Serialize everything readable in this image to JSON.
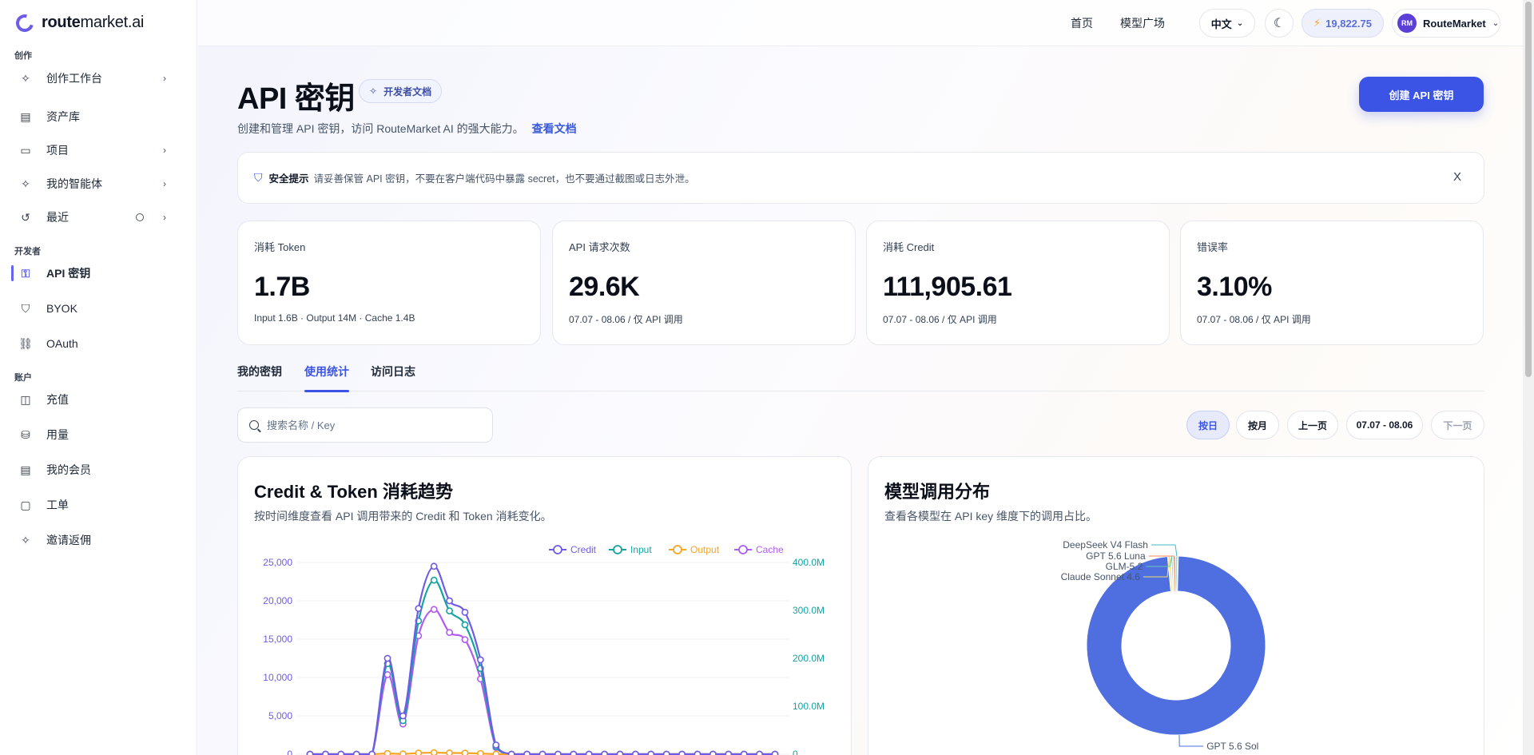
{
  "brand": {
    "name_bold": "route",
    "name_rest": "market.ai"
  },
  "sidebar": {
    "sections": {
      "create": "创作",
      "developer": "开发者",
      "account": "账户"
    },
    "items": [
      {
        "label": "创作工作台",
        "icon": "sparkle-icon"
      },
      {
        "label": "资产库",
        "icon": "library-icon"
      },
      {
        "label": "项目",
        "icon": "folder-icon"
      },
      {
        "label": "我的智能体",
        "icon": "agent-icon"
      },
      {
        "label": "最近",
        "icon": "history-icon"
      },
      {
        "label": "API 密钥",
        "icon": "key-icon"
      },
      {
        "label": "BYOK",
        "icon": "shield-icon"
      },
      {
        "label": "OAuth",
        "icon": "link-icon"
      },
      {
        "label": "充值",
        "icon": "wallet-icon"
      },
      {
        "label": "用量",
        "icon": "database-icon"
      },
      {
        "label": "我的会员",
        "icon": "receipt-icon"
      },
      {
        "label": "工单",
        "icon": "message-icon"
      },
      {
        "label": "邀请返佣",
        "icon": "sparkle-icon"
      }
    ]
  },
  "topbar": {
    "links": [
      "首页",
      "模型广场"
    ],
    "lang": "中文",
    "credits": "19,822.75",
    "user": {
      "initials": "RM",
      "name": "RouteMarket"
    }
  },
  "header": {
    "title": "API 密钥",
    "doc_chip": "开发者文档",
    "subtitle": "创建和管理 API 密钥，访问 RouteMarket AI 的强大能力。",
    "doc_link": "查看文档",
    "create_button": "创建 API 密钥"
  },
  "notice": {
    "title": "安全提示",
    "text": "请妥善保管 API 密钥，不要在客户端代码中暴露 secret，也不要通过截图或日志外泄。",
    "close": "X"
  },
  "stats": [
    {
      "label": "消耗 Token",
      "value": "1.7B",
      "sub": "Input 1.6B · Output 14M · Cache 1.4B"
    },
    {
      "label": "API 请求次数",
      "value": "29.6K",
      "sub": "07.07 - 08.06 / 仅 API 调用"
    },
    {
      "label": "消耗 Credit",
      "value": "111,905.61",
      "sub": "07.07 - 08.06 / 仅 API 调用"
    },
    {
      "label": "错误率",
      "value": "3.10%",
      "sub": "07.07 - 08.06 / 仅 API 调用"
    }
  ],
  "tabs": [
    "我的密钥",
    "使用统计",
    "访问日志"
  ],
  "search": {
    "placeholder": "搜索名称 / Key"
  },
  "filters": {
    "by_day": "按日",
    "by_month": "按月",
    "prev": "上一页",
    "range": "07.07 - 08.06",
    "next": "下一页"
  },
  "trend_card": {
    "title": "Credit & Token 消耗趋势",
    "desc": "按时间维度查看 API 调用带来的 Credit 和 Token 消耗变化。"
  },
  "dist_card": {
    "title": "模型调用分布",
    "desc": "查看各模型在 API key 维度下的调用占比。"
  },
  "chart_data": [
    {
      "type": "line",
      "legend": [
        "Credit",
        "Input",
        "Output",
        "Cache"
      ],
      "legend_position": "top-right",
      "y_left": {
        "ticks": [
          "0",
          "5,000",
          "10,000",
          "15,000",
          "20,000",
          "25,000"
        ],
        "range": [
          0,
          25000
        ]
      },
      "y_right": {
        "ticks": [
          "0",
          "100.0M",
          "200.0M",
          "300.0M",
          "400.0M"
        ],
        "range": [
          0,
          400000000
        ]
      },
      "series": [
        {
          "name": "Credit",
          "axis": "left",
          "color": "#6e5ce6",
          "values": [
            0,
            0,
            0,
            0,
            0,
            12500,
            5000,
            19000,
            24500,
            20000,
            18500,
            12300,
            1200,
            0,
            0,
            0,
            0,
            0,
            0,
            0,
            0,
            0,
            0,
            0,
            0,
            0,
            0,
            0,
            0,
            0,
            0
          ]
        },
        {
          "name": "Input",
          "axis": "right",
          "color": "#14a3a3",
          "values": [
            0,
            0,
            0,
            0,
            0,
            189000000,
            70000000,
            278000000,
            363000000,
            299000000,
            270000000,
            179000000,
            16000000,
            0,
            0,
            0,
            0,
            0,
            0,
            0,
            0,
            0,
            0,
            0,
            0,
            0,
            0,
            0,
            0,
            0,
            0
          ]
        },
        {
          "name": "Output",
          "axis": "right",
          "color": "#f5a524",
          "values": [
            0,
            0,
            0,
            0,
            0,
            1500000,
            500000,
            2400000,
            3200000,
            2600000,
            2300000,
            1500000,
            100000,
            0,
            0,
            0,
            0,
            0,
            0,
            0,
            0,
            0,
            0,
            0,
            0,
            0,
            0,
            0,
            0,
            0,
            0
          ]
        },
        {
          "name": "Cache",
          "axis": "right",
          "color": "#b05cf0",
          "values": [
            0,
            0,
            0,
            0,
            0,
            166000000,
            63000000,
            247000000,
            302000000,
            254000000,
            239000000,
            157000000,
            14000000,
            0,
            0,
            0,
            0,
            0,
            0,
            0,
            0,
            0,
            0,
            0,
            0,
            0,
            0,
            0,
            0,
            0,
            0
          ]
        }
      ]
    },
    {
      "type": "pie",
      "slices": [
        {
          "label": "GPT 5.6 Sol",
          "value": 98.2,
          "color": "#4f6ee0"
        },
        {
          "label": "Claude Sonnet 4.6",
          "value": 0.5,
          "color": "#ede26a"
        },
        {
          "label": "GLM-5.2",
          "value": 0.4,
          "color": "#64c8b4"
        },
        {
          "label": "GPT 5.6 Luna",
          "value": 0.5,
          "color": "#f08a5d"
        },
        {
          "label": "DeepSeek V4 Flash",
          "value": 0.4,
          "color": "#3fb8c9"
        }
      ]
    }
  ]
}
